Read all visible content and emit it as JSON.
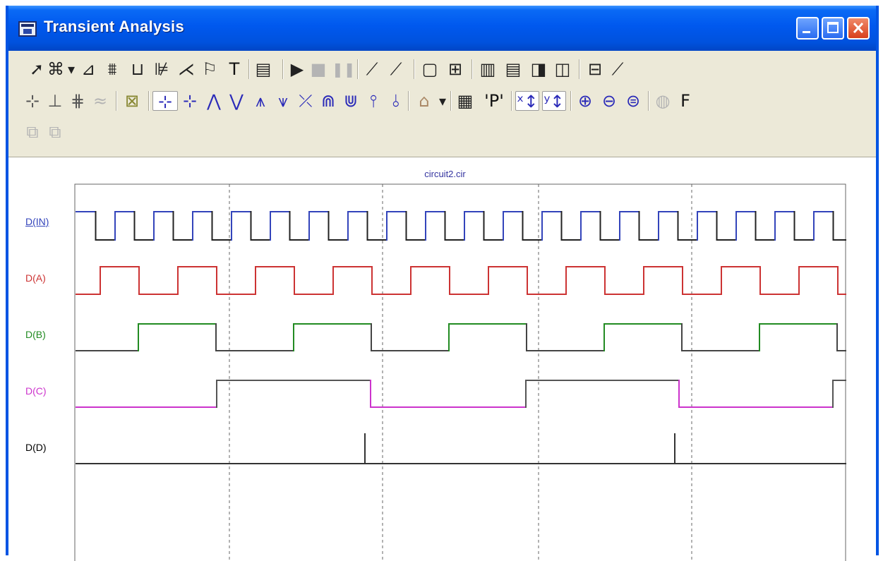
{
  "window": {
    "title": "Transient Analysis"
  },
  "toolbar": {
    "row1": [
      {
        "name": "select-tool-icon",
        "glyph": "➚"
      },
      {
        "name": "component-tool-icon",
        "glyph": "⌘"
      },
      {
        "name": "dropdown-arrow-icon",
        "glyph": "▾"
      },
      {
        "name": "wire-tool-icon",
        "glyph": "⊿"
      },
      {
        "name": "bus-tool-icon",
        "glyph": "⩩"
      },
      {
        "name": "box-tool-icon",
        "glyph": "⊔"
      },
      {
        "name": "probe-tool-icon",
        "glyph": "⊯"
      },
      {
        "name": "node-tool-icon",
        "glyph": "⋌"
      },
      {
        "name": "flag-tool-icon",
        "glyph": "⚐"
      },
      {
        "name": "text-tool-icon",
        "glyph": "T"
      },
      {
        "name": "properties-icon",
        "glyph": "▤"
      },
      {
        "name": "run-icon",
        "glyph": "▶"
      },
      {
        "name": "stop-icon",
        "glyph": "■"
      },
      {
        "name": "pause-icon",
        "glyph": "❚❚"
      },
      {
        "name": "line-tool-icon",
        "glyph": "⟋"
      },
      {
        "name": "diagonal-line-icon",
        "glyph": "⟋"
      },
      {
        "name": "frame-icon",
        "glyph": "▢"
      },
      {
        "name": "grid-icon",
        "glyph": "⊞"
      },
      {
        "name": "layout-vertical-icon",
        "glyph": "▥"
      },
      {
        "name": "layout-horizontal-icon",
        "glyph": "▤"
      },
      {
        "name": "layout-panel-icon",
        "glyph": "◨"
      },
      {
        "name": "layout-split-icon",
        "glyph": "◫"
      },
      {
        "name": "layout-bottom-icon",
        "glyph": "⊟"
      },
      {
        "name": "tangent-icon",
        "glyph": "⟋"
      }
    ],
    "row2": [
      {
        "name": "cursor-mode-1-icon",
        "glyph": "⊹"
      },
      {
        "name": "cursor-mode-2-icon",
        "glyph": "⊥"
      },
      {
        "name": "cursor-mode-3-icon",
        "glyph": "⋕"
      },
      {
        "name": "cursor-mode-4-icon",
        "glyph": "≈"
      },
      {
        "name": "delete-curve-icon",
        "glyph": "⊠"
      },
      {
        "name": "left-cursor-icon",
        "glyph": "⊹"
      },
      {
        "name": "right-cursor-icon",
        "glyph": "⊹"
      },
      {
        "name": "peak-icon",
        "glyph": "⋀"
      },
      {
        "name": "valley-icon",
        "glyph": "⋁"
      },
      {
        "name": "high-icon",
        "glyph": "⩚"
      },
      {
        "name": "low-icon",
        "glyph": "⩛"
      },
      {
        "name": "inflection-icon",
        "glyph": "⤫"
      },
      {
        "name": "global-high-icon",
        "glyph": "⋒"
      },
      {
        "name": "global-low-icon",
        "glyph": "⋓"
      },
      {
        "name": "next-level-icon",
        "glyph": "⫯"
      },
      {
        "name": "prev-level-icon",
        "glyph": "⫰"
      },
      {
        "name": "tag-icon",
        "glyph": "⌂"
      },
      {
        "name": "dropdown-arrow-2-icon",
        "glyph": "▾"
      },
      {
        "name": "table-icon",
        "glyph": "▦"
      },
      {
        "name": "performance-icon",
        "glyph": "'P'"
      },
      {
        "name": "x-axis-icon",
        "glyph": "ˣ↕"
      },
      {
        "name": "y-axis-icon",
        "glyph": "ʸ↕"
      },
      {
        "name": "zoom-in-icon",
        "glyph": "⊕"
      },
      {
        "name": "zoom-out-icon",
        "glyph": "⊖"
      },
      {
        "name": "zoom-fit-icon",
        "glyph": "⊜"
      },
      {
        "name": "animate-icon",
        "glyph": "◍"
      },
      {
        "name": "font-icon",
        "glyph": "F"
      }
    ],
    "row3": [
      {
        "name": "copy-plot-icon",
        "glyph": "⧉"
      },
      {
        "name": "paste-plot-icon",
        "glyph": "⧉"
      }
    ]
  },
  "plot": {
    "title": "circuit2.cir",
    "signals": [
      {
        "label": "D(IN)",
        "color": "#3344bb",
        "low": "#222222",
        "high": "#3344bb",
        "pattern": "clock-in"
      },
      {
        "label": "D(A)",
        "color": "#cc3333",
        "low": "#cc3333",
        "high": "#cc3333",
        "pattern": "clock-a"
      },
      {
        "label": "D(B)",
        "color": "#228b22",
        "low": "#444444",
        "high": "#228b22",
        "pattern": "clock-b"
      },
      {
        "label": "D(C)",
        "color": "#cc33cc",
        "low": "#cc33cc",
        "high": "#555555",
        "pattern": "clock-c"
      },
      {
        "label": "D(D)",
        "color": "#000000",
        "low": "#333333",
        "high": "#333333",
        "pattern": "glitch"
      }
    ]
  }
}
